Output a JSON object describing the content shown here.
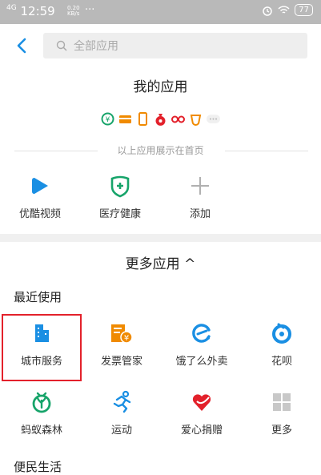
{
  "status_bar": {
    "signal": "4G",
    "time": "12:59",
    "speed_top": "0.20",
    "speed_unit": "KB/s",
    "dots": "···",
    "battery": "77"
  },
  "header": {
    "search_placeholder": "全部应用"
  },
  "my_apps": {
    "title": "我的应用",
    "home_hint": "以上应用展示在首页",
    "items": [
      {
        "label": "优酷视频",
        "icon": "youku-icon"
      },
      {
        "label": "医疗健康",
        "icon": "medical-health-icon"
      },
      {
        "label": "添加",
        "icon": "add-icon"
      }
    ],
    "mini_icons": [
      "yuebao-icon",
      "card-icon",
      "phone-icon",
      "money-bag-icon",
      "glasses-icon",
      "cup-icon",
      "more-dots-icon"
    ]
  },
  "more_apps": {
    "title": "更多应用 ^",
    "recent_label": "最近使用",
    "row1": [
      {
        "label": "城市服务",
        "icon": "city-service-icon"
      },
      {
        "label": "发票管家",
        "icon": "invoice-icon"
      },
      {
        "label": "饿了么外卖",
        "icon": "eleme-icon"
      },
      {
        "label": "花呗",
        "icon": "huabei-icon"
      }
    ],
    "row2": [
      {
        "label": "蚂蚁森林",
        "icon": "ant-forest-icon"
      },
      {
        "label": "运动",
        "icon": "sport-icon"
      },
      {
        "label": "爱心捐赠",
        "icon": "charity-icon"
      },
      {
        "label": "更多",
        "icon": "grid-more-icon"
      }
    ],
    "life_label": "便民生活"
  },
  "colors": {
    "accent_blue": "#1a8fe3",
    "orange": "#f08a00",
    "green": "#17a46a",
    "red": "#e3212b",
    "highlight": "#e3212b"
  }
}
